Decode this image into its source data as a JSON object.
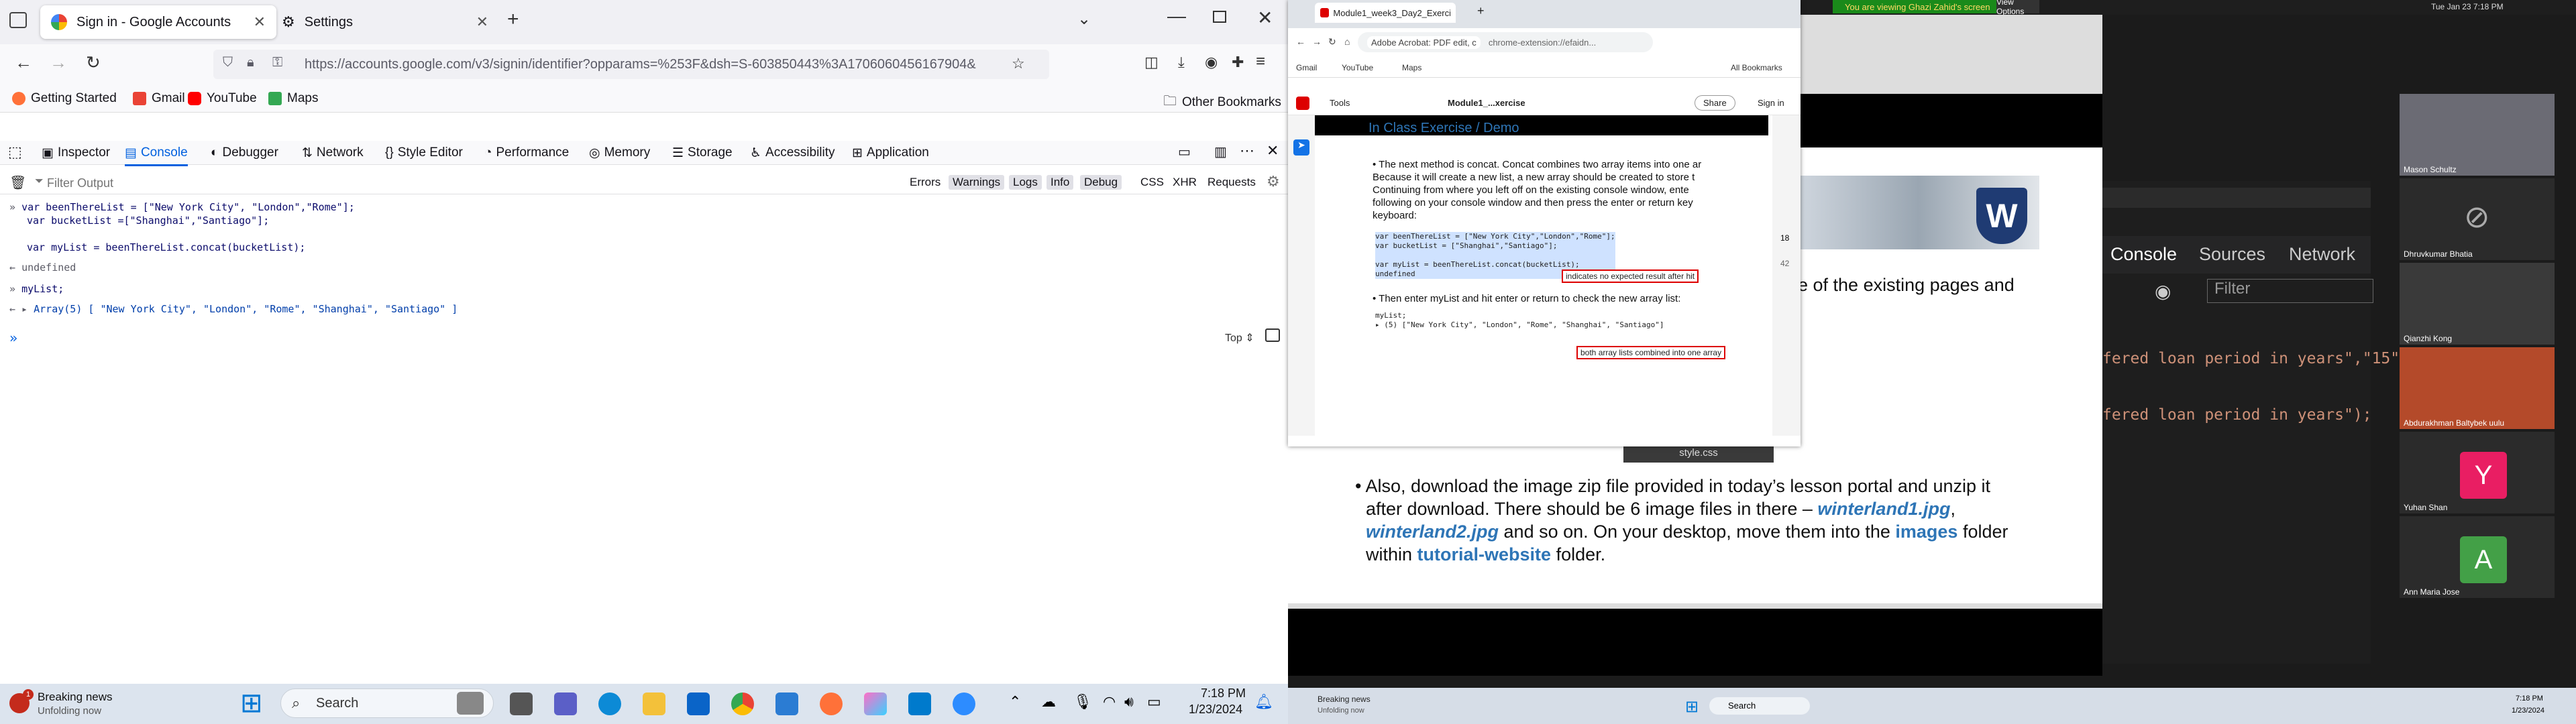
{
  "firefox": {
    "tabs": [
      {
        "title": "Sign in - Google Accounts"
      },
      {
        "title": "Settings"
      }
    ],
    "url": "https://accounts.google.com/v3/signin/identifier?opparams=%253F&dsh=S-603850443%3A1706060456167904&",
    "bookmarks": [
      "Getting Started",
      "Gmail",
      "YouTube",
      "Maps"
    ],
    "other_bookmarks": "Other Bookmarks"
  },
  "devtools": {
    "tabs": [
      "Inspector",
      "Console",
      "Debugger",
      "Network",
      "Style Editor",
      "Performance",
      "Memory",
      "Storage",
      "Accessibility",
      "Application"
    ],
    "filter_placeholder": "Filter Output",
    "filters": [
      "Errors",
      "Warnings",
      "Logs",
      "Info",
      "Debug",
      "CSS",
      "XHR",
      "Requests"
    ],
    "context": "Top",
    "lines": [
      "var beenThereList = [\"New York City\", \"London\",\"Rome\"];",
      "var bucketList =[\"Shanghai\",\"Santiago\"];",
      "",
      "var myList = beenThereList.concat(bucketList);",
      "undefined",
      "myList;",
      "Array(5) [ \"New York City\", \"London\", \"Rome\", \"Shanghai\", \"Santiago\" ]"
    ]
  },
  "screen_share": {
    "banner": "You are viewing Ghazi Zahid's screen",
    "view_options": "View Options",
    "datetime": "Tue Jan 23  7:18 PM",
    "chrome_tabs": [
      "Module1_week3_Day2_Exercis"
    ],
    "chrome_url_site": "Adobe Acrobat: PDF edit, c",
    "chrome_url": "chrome-extension://efaidn...",
    "chrome_bookmarks": [
      "Gmail",
      "YouTube",
      "Maps"
    ],
    "all_bookmarks": "All Bookmarks",
    "acrobat": {
      "tools": "Tools",
      "file": "Module1_...xercise",
      "share": "Share",
      "sign_in": "Sign in",
      "page": "18",
      "total": "42"
    },
    "pdf": {
      "heading": "In Class Exercise / Demo",
      "p1": [
        "The next method is concat. Concat combines two array items into one ar",
        "Because it will create a new list, a new array should be created to store t",
        "Continuing from where you left off on the existing console window, ente",
        "following on your console window and then press the enter or return key",
        "keyboard:"
      ],
      "code1": "var beenThereList = [\"New York City\",\"London\",\"Rome\"];\nvar bucketList = [\"Shanghai\",\"Santiago\"];\n\nvar myList = beenThereList.concat(bucketList);\nundefined",
      "note1": "indicates no expected result after hit",
      "p2": "Then enter myList and hit enter or return to check the new array list:",
      "code2": "myList;\n▸ (5) [\"New York City\", \"London\", \"Rome\", \"Shanghai\", \"Santiago\"]",
      "note2": "both array lists combined into one array"
    },
    "slide_partial": "e of the existing pages and",
    "slide_text": [
      "Also, download the image zip file provided in today’s lesson portal and unzip it",
      "after download. There should be 6 image files in there – ",
      "winterland1.jpg",
      ",",
      "winterland2.jpg",
      " and so on. On your desktop, move them into the ",
      "images",
      " folder",
      "within ",
      "tutorial-website",
      " folder."
    ],
    "vs_tabs": [
      "Console",
      "Sources",
      "Network"
    ],
    "vs_filter": "Filter",
    "code_lines": [
      "fered loan period in years\",\"15\");",
      "fered loan period in years\");"
    ],
    "style_tab": "style.css",
    "participants": [
      {
        "name": "Mason Schultz"
      },
      {
        "name": "Dhruvkumar Bhatia"
      },
      {
        "name": "Qianzhi Kong"
      },
      {
        "name": "Abdurakhman Baltybek uulu"
      },
      {
        "name": "Yuhan Shan",
        "initial": "Y",
        "color": "#e91e63"
      },
      {
        "name": "Ann Maria Jose",
        "initial": "A",
        "color": "#43a047"
      }
    ],
    "news": {
      "title": "Breaking news",
      "sub": "Unfolding now"
    },
    "search": "Search",
    "clock": {
      "time": "7:18 PM",
      "date": "1/23/2024"
    }
  },
  "taskbar": {
    "news": {
      "title": "Breaking news",
      "sub": "Unfolding now",
      "badge": "1"
    },
    "search": "Search",
    "time": "7:18 PM",
    "date": "1/23/2024"
  }
}
